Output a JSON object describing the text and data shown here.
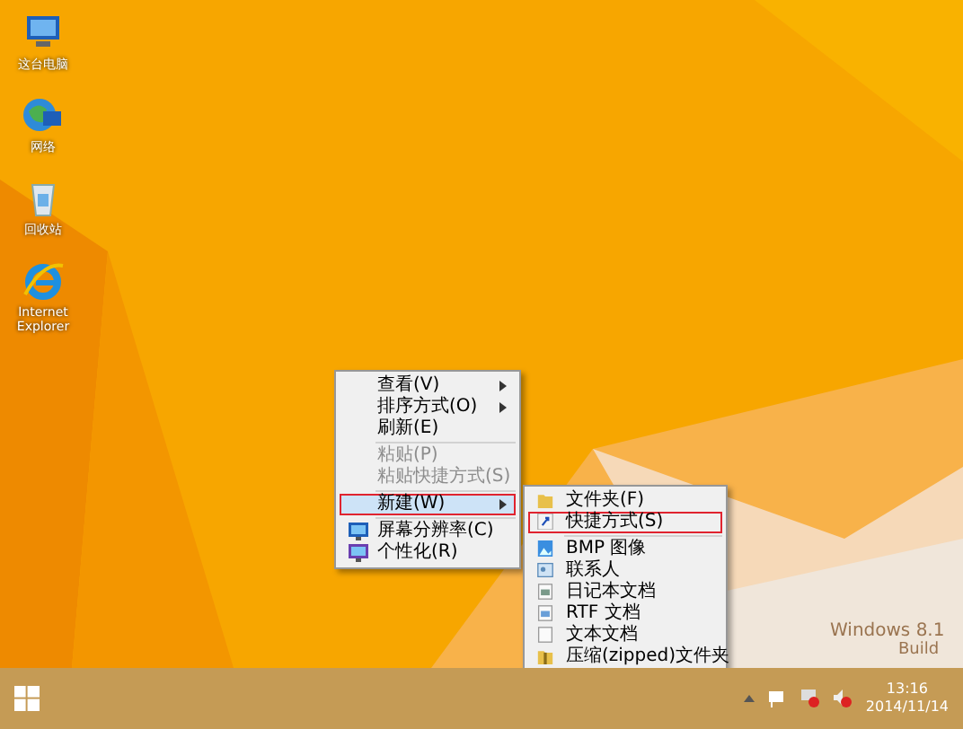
{
  "desktop_icons": [
    {
      "kind": "computer",
      "label": "这台电脑"
    },
    {
      "kind": "network",
      "label": "网络"
    },
    {
      "kind": "recycle",
      "label": "回收站"
    },
    {
      "kind": "ie",
      "label": "Internet Explorer"
    }
  ],
  "watermark": [
    "Windows 8.1",
    "Build"
  ],
  "context_menu": {
    "items": [
      {
        "kind": "item",
        "label": "查看(V)",
        "submenu": true,
        "disabled": false,
        "selected": false,
        "outlined": false
      },
      {
        "kind": "item",
        "label": "排序方式(O)",
        "submenu": true,
        "disabled": false,
        "selected": false,
        "outlined": false
      },
      {
        "kind": "item",
        "label": "刷新(E)",
        "submenu": false,
        "disabled": false,
        "selected": false,
        "outlined": false
      },
      {
        "kind": "separator"
      },
      {
        "kind": "item",
        "label": "粘贴(P)",
        "submenu": false,
        "disabled": true,
        "selected": false,
        "outlined": false
      },
      {
        "kind": "item",
        "label": "粘贴快捷方式(S)",
        "submenu": false,
        "disabled": true,
        "selected": false,
        "outlined": false
      },
      {
        "kind": "separator"
      },
      {
        "kind": "item",
        "label": "新建(W)",
        "submenu": true,
        "disabled": false,
        "selected": true,
        "outlined": true
      },
      {
        "kind": "separator"
      },
      {
        "kind": "item",
        "label": "屏幕分辨率(C)",
        "submenu": false,
        "disabled": false,
        "selected": false,
        "outlined": false
      },
      {
        "kind": "item",
        "label": "个性化(R)",
        "submenu": false,
        "disabled": false,
        "selected": false,
        "outlined": false
      }
    ]
  },
  "new_submenu": {
    "items": [
      {
        "kind": "item",
        "label": "文件夹(F)",
        "outlined": false
      },
      {
        "kind": "item",
        "label": "快捷方式(S)",
        "outlined": true
      },
      {
        "kind": "separator"
      },
      {
        "kind": "item",
        "label": "BMP 图像",
        "outlined": false
      },
      {
        "kind": "item",
        "label": "联系人",
        "outlined": false
      },
      {
        "kind": "item",
        "label": "日记本文档",
        "outlined": false
      },
      {
        "kind": "item",
        "label": "RTF 文档",
        "outlined": false
      },
      {
        "kind": "item",
        "label": "文本文档",
        "outlined": false
      },
      {
        "kind": "item",
        "label": "压缩(zipped)文件夹",
        "outlined": false
      }
    ]
  },
  "taskbar": {
    "time": "13:16",
    "date": "2014/11/14"
  }
}
